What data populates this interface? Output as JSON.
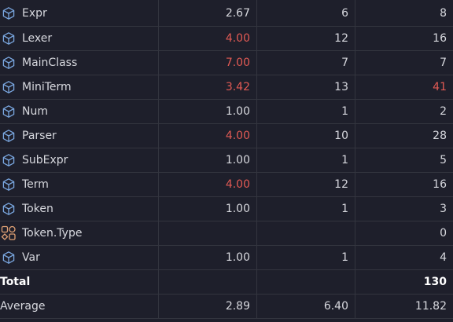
{
  "colors": {
    "warning": "#e25a54",
    "class_icon": "#7aa7e0",
    "enum_icon": "#e0a174"
  },
  "rows": [
    {
      "name": "Expr",
      "icon": "class-icon",
      "wmc": "2.67",
      "wmc_warn": false,
      "noc": "6",
      "loc": "8",
      "loc_warn": false
    },
    {
      "name": "Lexer",
      "icon": "class-icon",
      "wmc": "4.00",
      "wmc_warn": true,
      "noc": "12",
      "loc": "16",
      "loc_warn": false
    },
    {
      "name": "MainClass",
      "icon": "class-icon",
      "wmc": "7.00",
      "wmc_warn": true,
      "noc": "7",
      "loc": "7",
      "loc_warn": false
    },
    {
      "name": "MiniTerm",
      "icon": "class-icon",
      "wmc": "3.42",
      "wmc_warn": true,
      "noc": "13",
      "loc": "41",
      "loc_warn": true
    },
    {
      "name": "Num",
      "icon": "class-icon",
      "wmc": "1.00",
      "wmc_warn": false,
      "noc": "1",
      "loc": "2",
      "loc_warn": false
    },
    {
      "name": "Parser",
      "icon": "class-icon",
      "wmc": "4.00",
      "wmc_warn": true,
      "noc": "10",
      "loc": "28",
      "loc_warn": false
    },
    {
      "name": "SubExpr",
      "icon": "class-icon",
      "wmc": "1.00",
      "wmc_warn": false,
      "noc": "1",
      "loc": "5",
      "loc_warn": false
    },
    {
      "name": "Term",
      "icon": "class-icon",
      "wmc": "4.00",
      "wmc_warn": true,
      "noc": "12",
      "loc": "16",
      "loc_warn": false
    },
    {
      "name": "Token",
      "icon": "class-icon",
      "wmc": "1.00",
      "wmc_warn": false,
      "noc": "1",
      "loc": "3",
      "loc_warn": false
    },
    {
      "name": "Token.Type",
      "icon": "enum-icon",
      "wmc": "",
      "wmc_warn": false,
      "noc": "",
      "loc": "0",
      "loc_warn": false
    },
    {
      "name": "Var",
      "icon": "class-icon",
      "wmc": "1.00",
      "wmc_warn": false,
      "noc": "1",
      "loc": "4",
      "loc_warn": false
    }
  ],
  "total": {
    "label": "Total",
    "wmc": "",
    "noc": "",
    "loc": "130"
  },
  "average": {
    "label": "Average",
    "wmc": "2.89",
    "noc": "6.40",
    "loc": "11.82"
  }
}
